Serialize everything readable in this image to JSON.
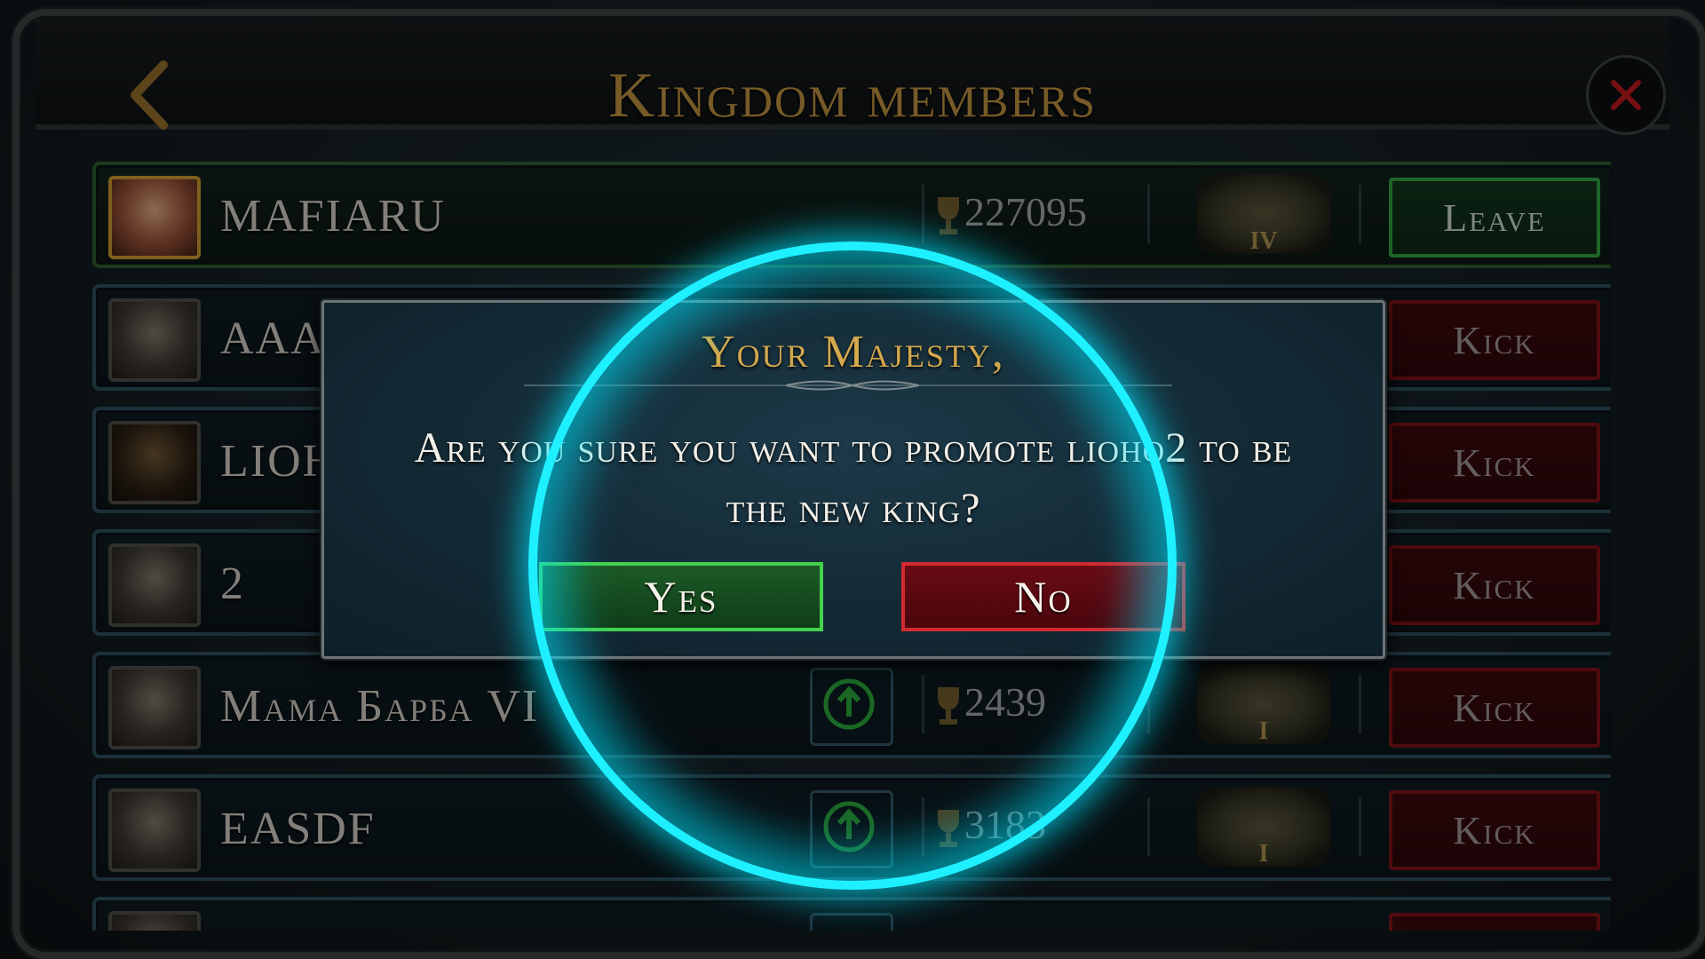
{
  "header": {
    "title": "Kingdom members"
  },
  "members": [
    {
      "name": "MAFIARU",
      "score": "227095",
      "rank": "IV",
      "action": "Leave",
      "self": true,
      "avatar": "queen-portrait"
    },
    {
      "name": "AAA",
      "score": "",
      "rank": "",
      "action": "Kick",
      "self": false,
      "avatar": "helmet-portrait"
    },
    {
      "name": "LIOH",
      "score": "",
      "rank": "",
      "action": "Kick",
      "self": false,
      "avatar": "warrior-portrait"
    },
    {
      "name": "2",
      "score": "",
      "rank": "",
      "action": "Kick",
      "self": false,
      "avatar": "helmet-portrait"
    },
    {
      "name": "Мама Барба VI",
      "score": "2439",
      "rank": "I",
      "action": "Kick",
      "self": false,
      "avatar": "helmet-portrait"
    },
    {
      "name": "EASDF",
      "score": "3183",
      "rank": "I",
      "action": "Kick",
      "self": false,
      "avatar": "helmet-portrait"
    }
  ],
  "dialog": {
    "title": "Your Majesty,",
    "message": "Are you sure you want to promote lioho2 to be the new king?",
    "yes_label": "Yes",
    "no_label": "No"
  },
  "colors": {
    "accent_gold": "#b58a3c",
    "kick_red": "#7a1118",
    "leave_green": "#2f9a3e",
    "highlight_cyan": "#1ff0ff"
  }
}
